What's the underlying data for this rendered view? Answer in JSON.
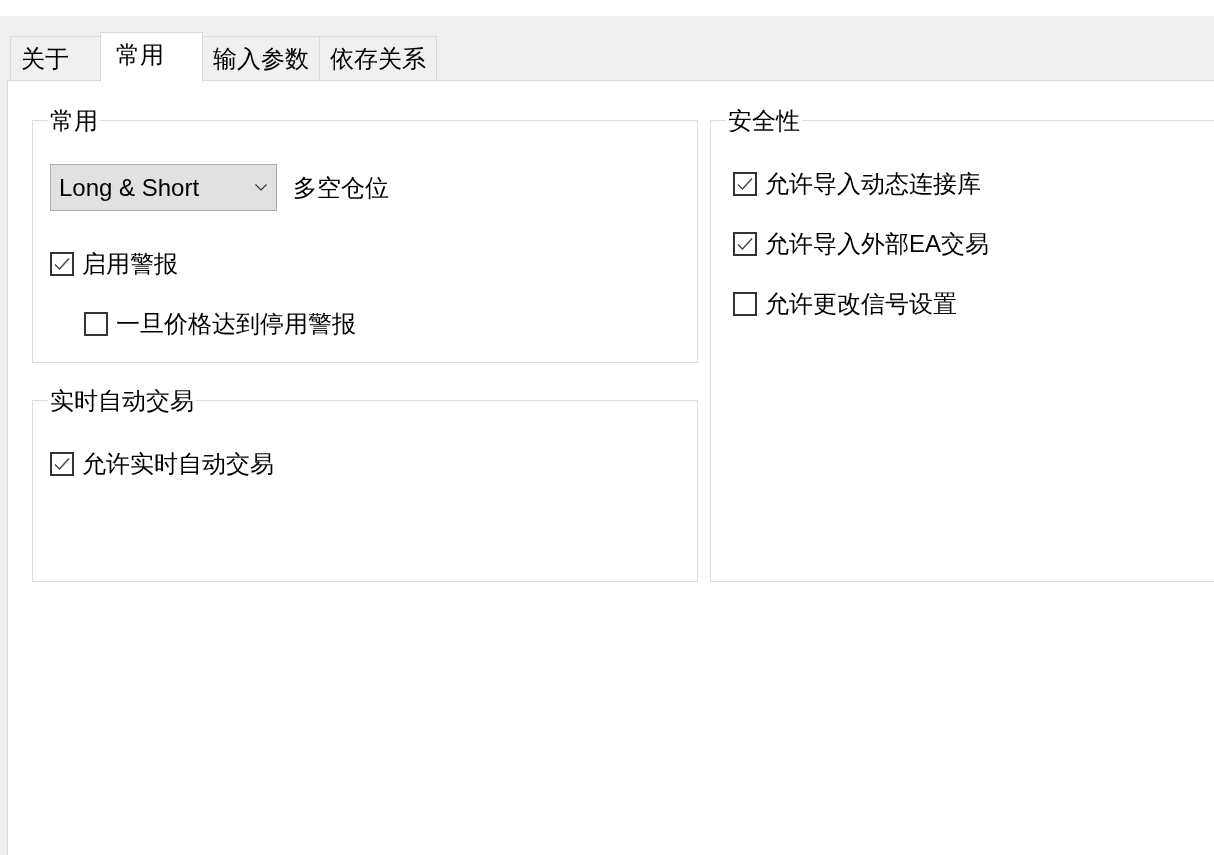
{
  "tabs": [
    {
      "label": "关于",
      "selected": false
    },
    {
      "label": "常用",
      "selected": true
    },
    {
      "label": "输入参数",
      "selected": false
    },
    {
      "label": "依存关系",
      "selected": false
    }
  ],
  "columns": [
    {
      "groups": [
        {
          "title": "常用",
          "items": [
            {
              "kind": "dropdown",
              "value": "Long & Short",
              "label": "多空仓位"
            },
            {
              "kind": "checkbox",
              "label": "启用警报",
              "checked": true,
              "children": [
                {
                  "kind": "checkbox",
                  "label": "一旦价格达到停用警报",
                  "checked": false
                }
              ]
            }
          ]
        },
        {
          "title": "实时自动交易",
          "items": [
            {
              "kind": "checkbox",
              "label": "允许实时自动交易",
              "checked": true
            }
          ]
        }
      ]
    },
    {
      "groups": [
        {
          "title": "安全性",
          "items": [
            {
              "kind": "checkbox",
              "label": "允许导入动态连接库",
              "checked": true
            },
            {
              "kind": "checkbox",
              "label": "允许导入外部EA交易",
              "checked": true
            },
            {
              "kind": "checkbox",
              "label": "允许更改信号设置",
              "checked": false
            }
          ]
        }
      ]
    }
  ]
}
